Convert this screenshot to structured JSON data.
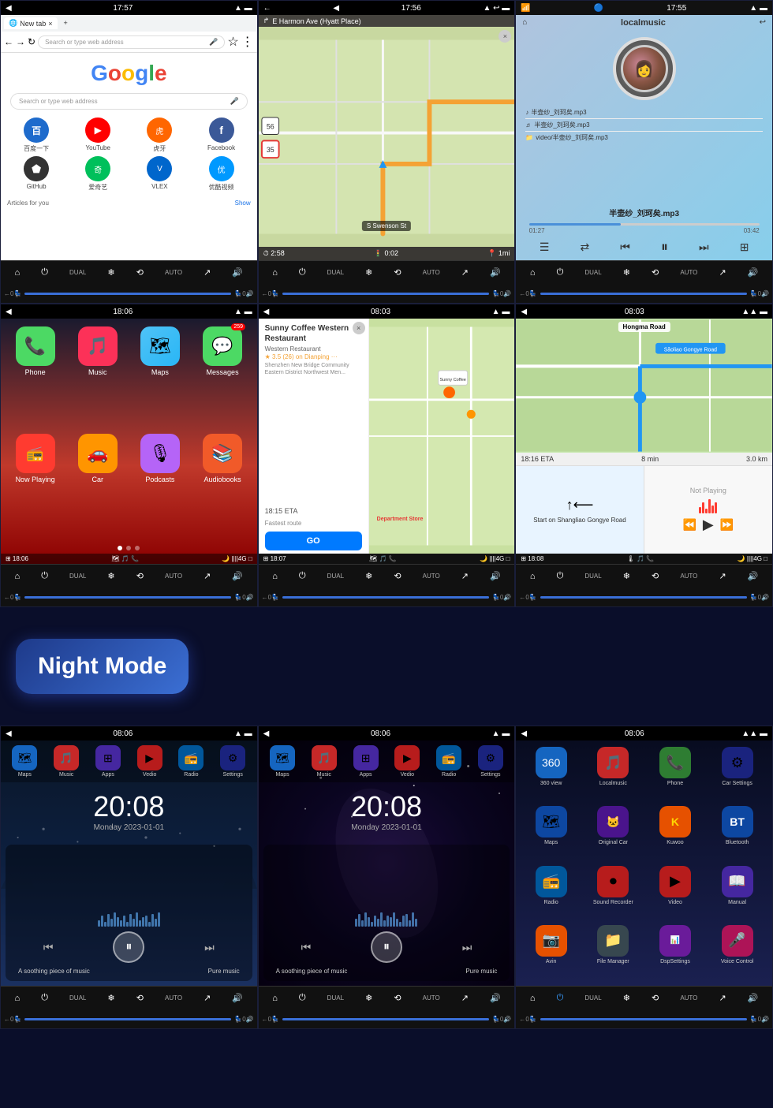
{
  "screens": {
    "row1": [
      {
        "id": "chrome",
        "time": "17:57",
        "title": "New tab",
        "search_placeholder": "Search or type web address",
        "google_text": "Google",
        "search_bar_text": "Search or type web address",
        "quick_links": [
          {
            "label": "百度一下",
            "icon": "🔵",
            "color": "#4285F4"
          },
          {
            "label": "YouTube",
            "icon": "▶",
            "color": "#FF0000"
          },
          {
            "label": "虎牙",
            "icon": "🔴",
            "color": "#e62e2e"
          },
          {
            "label": "Facebook",
            "icon": "f",
            "color": "#3b5998"
          },
          {
            "label": "GitHub",
            "icon": "⚫",
            "color": "#333"
          },
          {
            "label": "爱奇艺",
            "icon": "🟢",
            "color": "#00c05b"
          },
          {
            "label": "VLEX",
            "icon": "🔵",
            "color": "#0066cc"
          },
          {
            "label": "优酷视频",
            "icon": "🔵",
            "color": "#09f"
          }
        ],
        "articles_label": "Articles for you",
        "show_label": "Show"
      },
      {
        "id": "navigation",
        "time": "17:56",
        "destination": "E Harmon Ave (Hyatt Place)",
        "eta1": "2:58",
        "eta2": "0:02",
        "distance": "1mi",
        "speed": "56",
        "speed2": "35",
        "street": "S Swenson St"
      },
      {
        "id": "music",
        "time": "17:55",
        "title": "localmusic",
        "track1": "半壶纱_刘珂矣.mp3",
        "track2": "半壶纱_刘珂矣.mp3",
        "track3": "video/半壶纱_刘珂矣.mp3",
        "current_track": "半壶纱_刘珂矣.mp3",
        "time_current": "01:27",
        "time_total": "03:42"
      }
    ],
    "row2": [
      {
        "id": "carplay-home",
        "time": "18:06",
        "apps": [
          {
            "label": "Phone",
            "icon": "📞",
            "color": "#4CD964",
            "badge": null
          },
          {
            "label": "Music",
            "icon": "🎵",
            "color": "#FC3158",
            "badge": null
          },
          {
            "label": "Maps",
            "icon": "🗺",
            "color": "#53D8FB",
            "badge": null
          },
          {
            "label": "Messages",
            "icon": "💬",
            "color": "#4CD964",
            "badge": "259"
          },
          {
            "label": "Now Playing",
            "icon": "📻",
            "color": "#FF3B30",
            "badge": null
          },
          {
            "label": "Car",
            "icon": "🚗",
            "color": "#FF9500",
            "badge": null
          },
          {
            "label": "Podcasts",
            "icon": "🎙",
            "color": "#B564F7",
            "badge": null
          },
          {
            "label": "Audiobooks",
            "icon": "📚",
            "color": "#F15A29",
            "badge": null
          }
        ],
        "bottom_time": "18:06",
        "status": "🌙 ||||4G □"
      },
      {
        "id": "carplay-maps",
        "time": "08:03",
        "restaurant_name": "Sunny Coffee Western Restaurant",
        "restaurant_type": "Western Restaurant",
        "restaurant_rating": "★ 3.5 (26) on Dianping ···",
        "restaurant_desc": "Shenzhen New Bridge Community Eastern District Northwest Men...",
        "eta": "18:15 ETA",
        "route_type": "Fastest route",
        "go_label": "GO",
        "bottom_time": "18:07",
        "department_store": "Department Store"
      },
      {
        "id": "carplay-nav",
        "time": "08:03",
        "road_name": "Hongma Road",
        "eta_time": "18:16 ETA",
        "eta_mins": "8 min",
        "eta_km": "3.0 km",
        "direction": "Start on Shangliao Gongye Road",
        "not_playing": "Not Playing",
        "bottom_time": "18:08",
        "status": "🌙 ||||4G □"
      }
    ],
    "night_label": "Night Mode",
    "row3": [
      {
        "id": "dark-home-1",
        "time": "08:06",
        "apps": [
          {
            "label": "Maps",
            "icon": "🗺",
            "color": "#2979ff"
          },
          {
            "label": "Music",
            "icon": "🎵",
            "color": "#e91e63"
          },
          {
            "label": "Apps",
            "icon": "⊞",
            "color": "#7c4dff"
          },
          {
            "label": "Vedio",
            "icon": "▶",
            "color": "#e53935"
          },
          {
            "label": "Radio",
            "icon": "📻",
            "color": "#039be5"
          },
          {
            "label": "Settings",
            "icon": "⚙",
            "color": "#3d5afe"
          }
        ],
        "clock_time": "20:08",
        "clock_date": "Monday  2023-01-01",
        "music_label1": "A soothing piece of music",
        "music_label2": "Pure music"
      },
      {
        "id": "dark-home-2",
        "time": "08:06",
        "apps": [
          {
            "label": "Maps",
            "icon": "🗺",
            "color": "#2979ff"
          },
          {
            "label": "Music",
            "icon": "🎵",
            "color": "#e91e63"
          },
          {
            "label": "Apps",
            "icon": "⊞",
            "color": "#7c4dff"
          },
          {
            "label": "Vedio",
            "icon": "▶",
            "color": "#e53935"
          },
          {
            "label": "Radio",
            "icon": "📻",
            "color": "#039be5"
          },
          {
            "label": "Settings",
            "icon": "⚙",
            "color": "#3d5afe"
          }
        ],
        "clock_time": "20:08",
        "clock_date": "Monday  2023-01-01",
        "music_label1": "A soothing piece of music",
        "music_label2": "Pure music"
      },
      {
        "id": "dark-app-grid",
        "time": "08:06",
        "apps": [
          {
            "label": "360 view",
            "icon": "🔵",
            "color": "#1565c0"
          },
          {
            "label": "Localmusic",
            "icon": "🎵",
            "color": "#e91e63"
          },
          {
            "label": "Phone",
            "icon": "📞",
            "color": "#4caf50"
          },
          {
            "label": "Car Settings",
            "icon": "⚙",
            "color": "#3d5afe"
          },
          {
            "label": "Maps",
            "icon": "🗺",
            "color": "#2979ff"
          },
          {
            "label": "Original Car",
            "icon": "🐱",
            "color": "#7c4dff"
          },
          {
            "label": "Kuwoo",
            "icon": "🎬",
            "color": "#ff9800"
          },
          {
            "label": "Bluetooth",
            "icon": "B",
            "color": "#1565c0"
          },
          {
            "label": "Radio",
            "icon": "📻",
            "color": "#039be5"
          },
          {
            "label": "Sound Recorder",
            "icon": "⏺",
            "color": "#e53935"
          },
          {
            "label": "Video",
            "icon": "▶",
            "color": "#e53935"
          },
          {
            "label": "Manual",
            "icon": "📖",
            "color": "#5c35cc"
          },
          {
            "label": "Avin",
            "icon": "📷",
            "color": "#ff9800"
          },
          {
            "label": "File Manager",
            "icon": "📁",
            "color": "#607d8b"
          },
          {
            "label": "DspSettings",
            "icon": "📊",
            "color": "#9c27b0"
          },
          {
            "label": "Voice Control",
            "icon": "🎤",
            "color": "#e91e63"
          }
        ]
      }
    ]
  },
  "ctrl": {
    "home_icon": "⌂",
    "power_icon": "⏻",
    "dual_label": "DUAL",
    "snow_icon": "❄",
    "sync_icon": "⟲",
    "auto_label": "AUTO",
    "curve_icon": "↗",
    "vol_icon": "🔊",
    "back_icon": "←",
    "temp_val": "0",
    "fan_icon": "💨",
    "temp2_val": "0"
  }
}
